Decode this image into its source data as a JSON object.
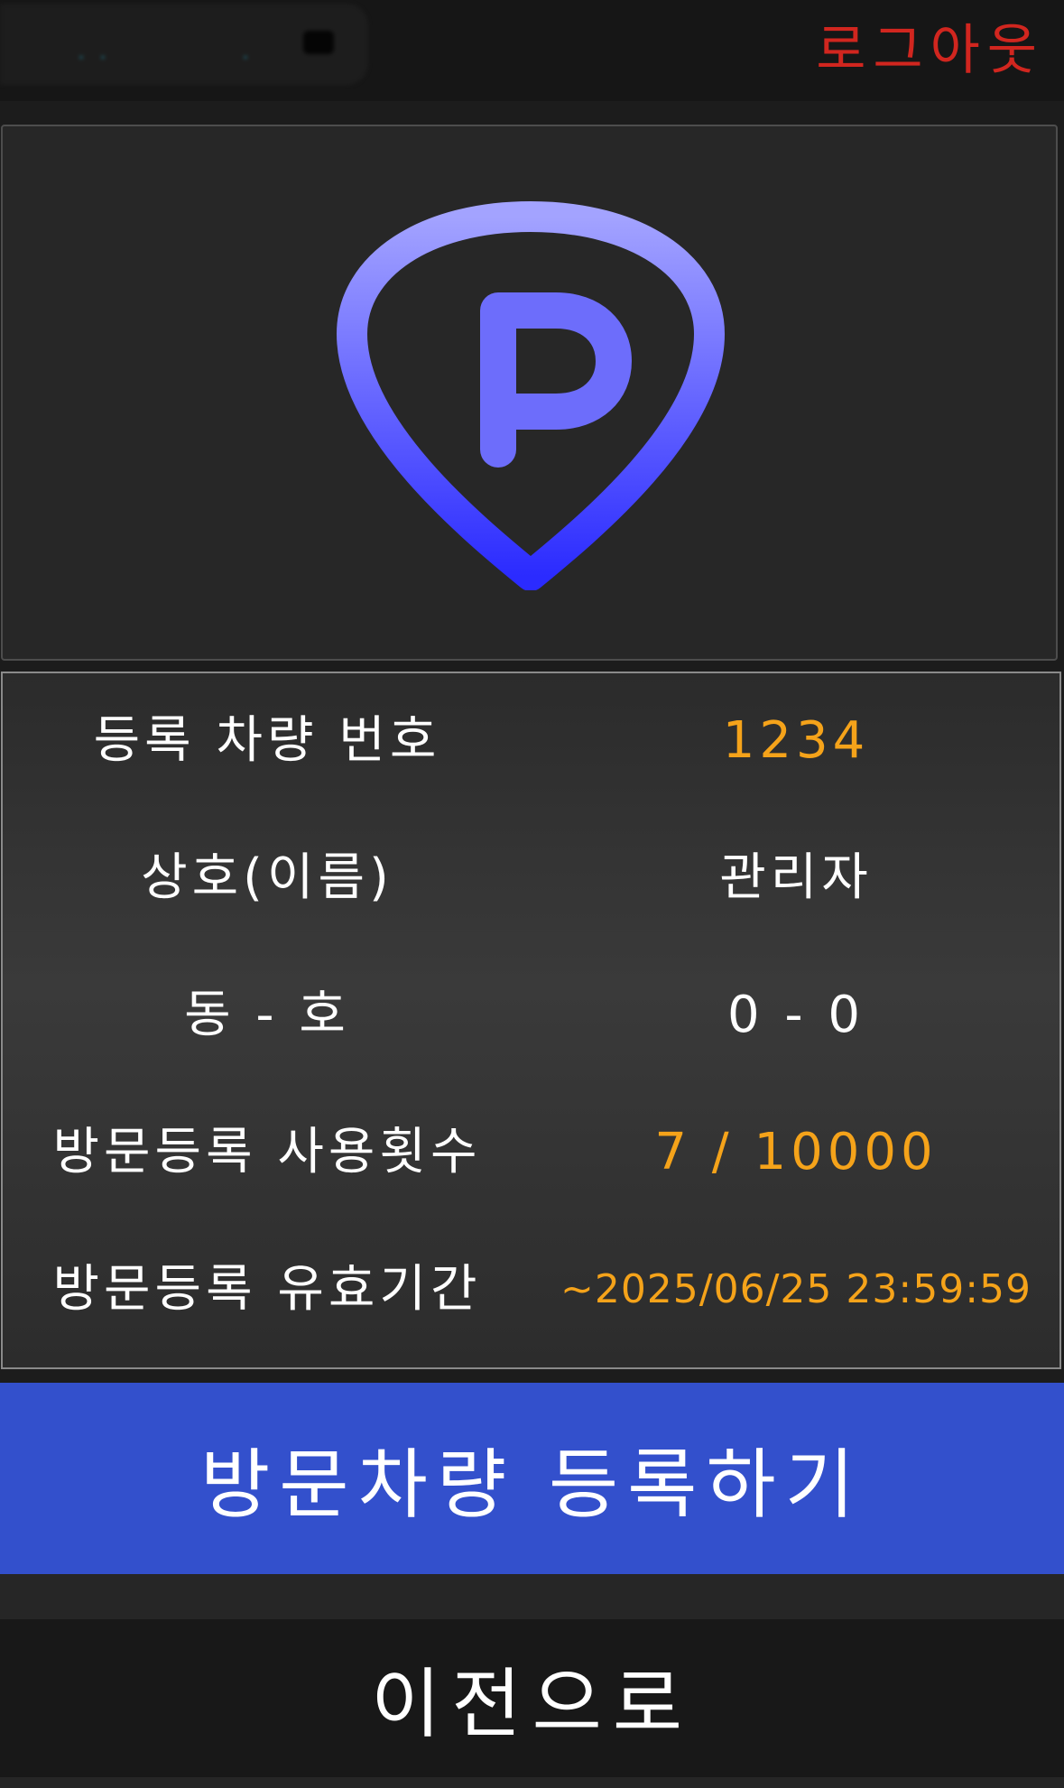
{
  "header": {
    "logout_label": "로그아웃"
  },
  "logo": {
    "icon": "parking-pin-icon",
    "gradient_top": "#a3a3ff",
    "gradient_bottom": "#2b2bff"
  },
  "info": {
    "rows": [
      {
        "label": "등록 차량 번호",
        "value": "1234"
      },
      {
        "label": "상호(이름)",
        "value": "관리자"
      },
      {
        "label": "동 - 호",
        "value": "0 - 0"
      },
      {
        "label": "방문등록 사용횟수",
        "value": "7 / 10000"
      },
      {
        "label": "방문등록 유효기간",
        "value": "~2025/06/25 23:59:59"
      }
    ]
  },
  "actions": {
    "register_label": "방문차량 등록하기",
    "back_label": "이전으로"
  },
  "colors": {
    "accent": "#f5a31a",
    "logout": "#d1261f",
    "primary_button": "#3350cc"
  }
}
